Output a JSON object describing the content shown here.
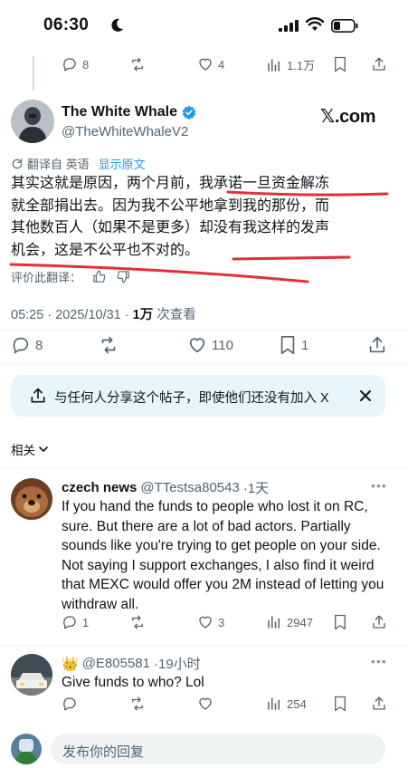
{
  "status_bar": {
    "time": "06:30"
  },
  "prev_tweet_actions": {
    "replies": "8",
    "views": "1.1万"
  },
  "prev_tweet_likes": "4",
  "tweet": {
    "author_name": "The White Whale",
    "handle": "@TheWhiteWhaleV2",
    "watermark": "𝕏.com",
    "translated_from": "翻译自 英语",
    "show_original": "显示原文",
    "body_lines": [
      "其实这就是原因，两个月前，我承诺一旦资金解冻",
      "就全部捐出去。因为我不公平地拿到我的那份，而",
      "其他数百人（如果不是更多）却没有我这样的发声",
      "机会，这是不公平也不对的。"
    ],
    "rate_label": "评价此翻译：",
    "time": "05:25 · 2025/10/31 · ",
    "views_count": "1万",
    "views_label": " 次查看",
    "replies": "8",
    "likes": "110",
    "bookmarks": "1"
  },
  "share_banner": {
    "text": "与任何人分享这个帖子，即使他们还没有加入 X"
  },
  "related_label": "相关",
  "replies": [
    {
      "name": "czech news",
      "handle": "@TTestsa80543",
      "age": "·1天",
      "text": "If you hand the funds to people who lost it on RC, sure. But there are a lot of bad actors. Partially sounds like you're trying to get people on your side. Not saying I support exchanges, I also find it weird that MEXC would offer you 2M instead of letting you withdraw all.",
      "reply_count": "1",
      "like_count": "3",
      "views": "2947"
    },
    {
      "name": "👑",
      "handle": "@E805581",
      "age": "·19小时",
      "text": "Give funds to who? Lol",
      "views": "254"
    }
  ],
  "composer": {
    "placeholder": "发布你的回复"
  },
  "colors": {
    "accent": "#1d9bf0",
    "underline": "#e0303a",
    "banner": "#e8f5fd",
    "muted": "#536471"
  }
}
